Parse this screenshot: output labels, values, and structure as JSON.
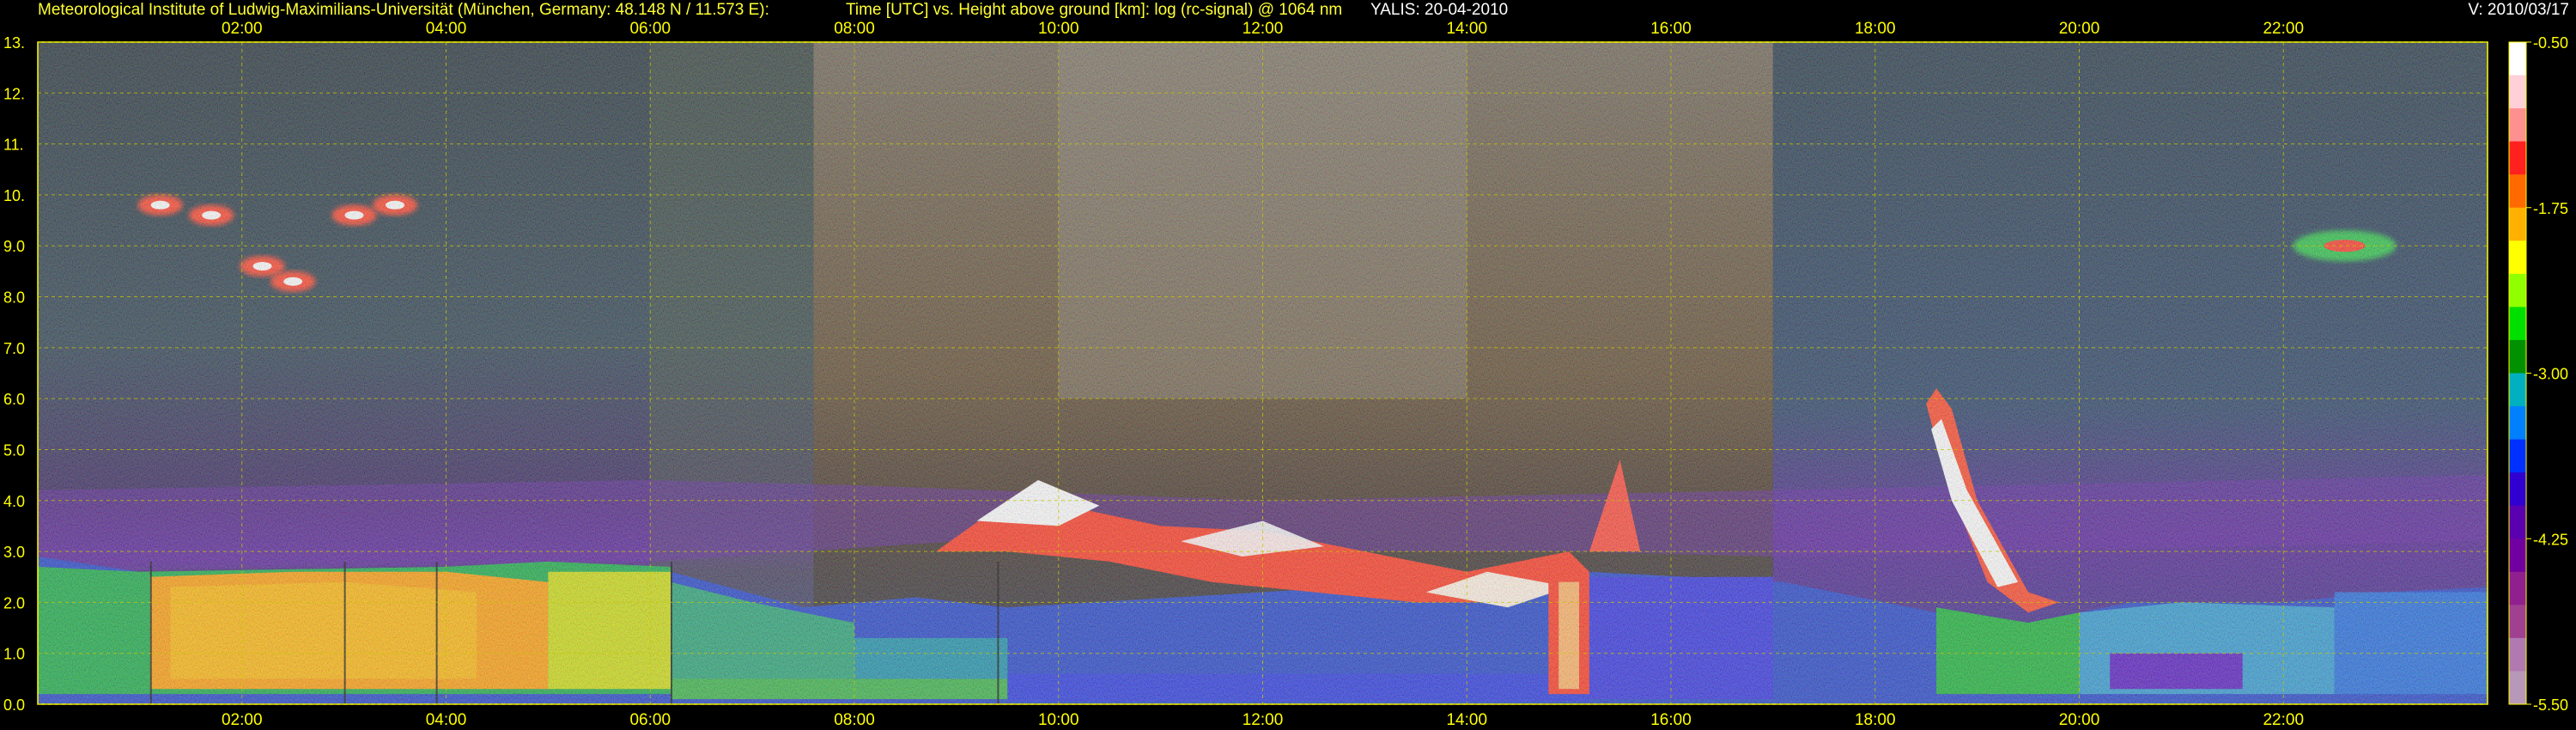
{
  "header": {
    "institute": "Meteorological Institute of Ludwig-Maximilians-Universität (München, Germany: 48.148 N / 11.573 E):",
    "title": "Time [UTC] vs. Height above ground [km]: log (rc-signal) @ 1064 nm",
    "instrument_date": "YALIS: 20-04-2010",
    "version": "V: 2010/03/17"
  },
  "chart_data": {
    "type": "heatmap",
    "title": "Time [UTC] vs. Height above ground [km]: log (rc-signal) @ 1064 nm",
    "x_unit": "hours UTC",
    "xlim": [
      0,
      24
    ],
    "x_tick_labels": [
      "02:00",
      "04:00",
      "06:00",
      "08:00",
      "10:00",
      "12:00",
      "14:00",
      "16:00",
      "18:00",
      "20:00",
      "22:00"
    ],
    "x_tick_values": [
      2,
      4,
      6,
      8,
      10,
      12,
      14,
      16,
      18,
      20,
      22
    ],
    "y_unit": "km",
    "ylim": [
      0,
      13
    ],
    "y_tick_labels": [
      "0.0",
      "1.0",
      "2.0",
      "3.0",
      "4.0",
      "5.0",
      "6.0",
      "7.0",
      "8.0",
      "9.0",
      "10.",
      "11.",
      "12.",
      "13."
    ],
    "y_tick_values": [
      0,
      1,
      2,
      3,
      4,
      5,
      6,
      7,
      8,
      9,
      10,
      11,
      12,
      13
    ],
    "grid": true,
    "colorbar": {
      "range": [
        -5.5,
        -0.5
      ],
      "tick_labels": [
        "-0.50",
        "-1.75",
        "-3.00",
        "-4.25",
        "-5.50"
      ],
      "tick_values": [
        -0.5,
        -1.75,
        -3.0,
        -4.25,
        -5.5
      ],
      "colors": [
        "#ffffff",
        "#ffd0d8",
        "#ff9090",
        "#ff2020",
        "#ff6a00",
        "#ffb000",
        "#ffff00",
        "#90ff00",
        "#00e000",
        "#009000",
        "#00b0c0",
        "#0080ff",
        "#0030ff",
        "#3000d0",
        "#5a00b0",
        "#7000a0",
        "#902090",
        "#a04090",
        "#b07ab0",
        "#b898b8"
      ]
    },
    "features": [
      {
        "name": "boundary layer aerosol",
        "t_start": 0.0,
        "t_end": 24.0,
        "top_km_approx": 2.5
      },
      {
        "name": "cirrus",
        "t_start": 1.1,
        "t_end": 4.0,
        "height_km": [
          8.0,
          10.0
        ]
      },
      {
        "name": "cirrus",
        "t_start": 22.2,
        "t_end": 22.9,
        "height_km": [
          8.5,
          9.3
        ]
      },
      {
        "name": "mid-level cloud",
        "t_start": 8.8,
        "t_end": 15.2,
        "height_km": [
          2.0,
          5.0
        ]
      },
      {
        "name": "falling cloud streak",
        "t_start": 18.6,
        "t_end": 19.6,
        "height_km": [
          1.8,
          6.2
        ]
      }
    ]
  }
}
